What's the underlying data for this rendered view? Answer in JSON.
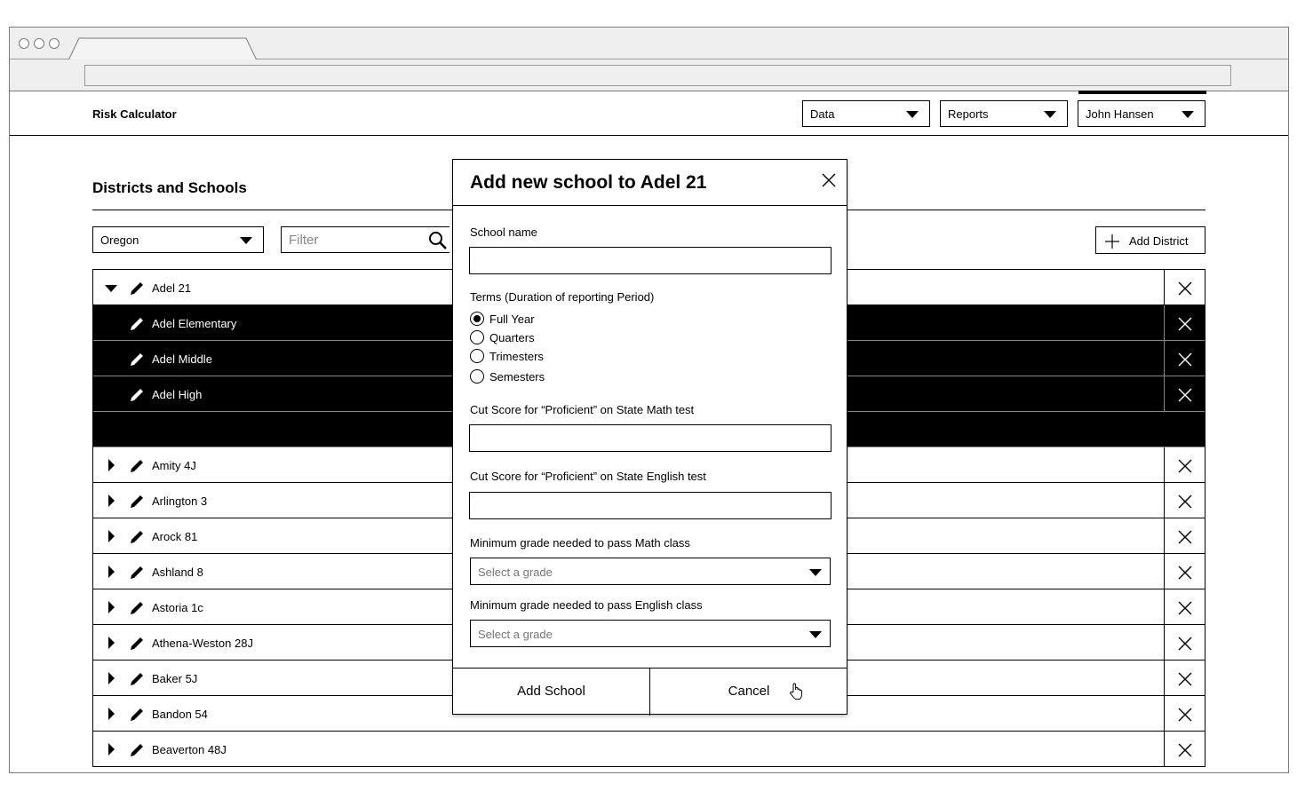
{
  "app": {
    "title": "Risk Calculator"
  },
  "nav": {
    "data_label": "Data",
    "reports_label": "Reports",
    "user_label": "John Hansen"
  },
  "page": {
    "title": "Districts and Schools",
    "state_select_value": "Oregon",
    "filter_placeholder": "Filter",
    "add_district_label": "Add District"
  },
  "districts": [
    {
      "label": "Adel 21",
      "expanded": true
    },
    {
      "label": "Adel Elementary",
      "school": true
    },
    {
      "label": "Adel Middle",
      "school": true
    },
    {
      "label": "Adel High",
      "school": true
    },
    {
      "label": "",
      "spacer": true
    },
    {
      "label": "Amity 4J"
    },
    {
      "label": "Arlington 3"
    },
    {
      "label": "Arock 81"
    },
    {
      "label": "Ashland 8"
    },
    {
      "label": "Astoria 1c"
    },
    {
      "label": "Athena-Weston 28J"
    },
    {
      "label": "Baker 5J"
    },
    {
      "label": "Bandon 54"
    },
    {
      "label": "Beaverton 48J"
    }
  ],
  "modal": {
    "title": "Add new school to Adel 21",
    "school_name_label": "School name",
    "school_name_value": "",
    "terms_label": "Terms (Duration of reporting Period)",
    "terms_options": [
      "Full Year",
      "Quarters",
      "Trimesters",
      "Semesters"
    ],
    "terms_selected": "Full Year",
    "math_cut_label": "Cut Score for “Proficient” on State Math test",
    "math_cut_value": "",
    "english_cut_label": "Cut Score for “Proficient” on State English test",
    "english_cut_value": "",
    "math_grade_label": "Minimum grade needed to pass Math class",
    "math_grade_placeholder": "Select a grade",
    "english_grade_label": "Minimum grade needed to pass English class",
    "english_grade_placeholder": "Select a grade",
    "add_button_label": "Add School",
    "cancel_button_label": "Cancel"
  },
  "icons": {
    "pencil": "pencil-icon",
    "delete": "close-icon",
    "search": "search-icon",
    "plus": "plus-icon",
    "cursor": "hand-pointer-icon"
  }
}
